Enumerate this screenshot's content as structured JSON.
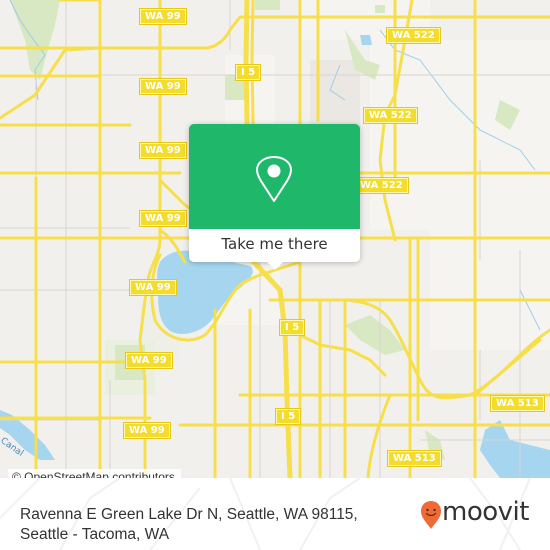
{
  "map": {
    "attribution": "© OpenStreetMap contributors",
    "water_label": "Canal",
    "shields": [
      {
        "label": "WA 99"
      },
      {
        "label": "WA 99"
      },
      {
        "label": "I 5"
      },
      {
        "label": "WA 522"
      },
      {
        "label": "WA 99"
      },
      {
        "label": "WA 522"
      },
      {
        "label": "WA 99"
      },
      {
        "label": "WA 522"
      },
      {
        "label": "WA 99"
      },
      {
        "label": "WA 99"
      },
      {
        "label": "WA 99"
      },
      {
        "label": "I 5"
      },
      {
        "label": "WA 99"
      },
      {
        "label": "I 5"
      },
      {
        "label": "WA 513"
      },
      {
        "label": "WA 513"
      }
    ],
    "colors": {
      "land": "#f2f0ed",
      "road": "#f6df4b",
      "water": "#a6d6ef",
      "park": "#cfe5b1"
    }
  },
  "popup": {
    "icon": "location-pin-icon",
    "button_label": "Take me there",
    "accent_color": "#1fb86a"
  },
  "footer": {
    "address_line1": "Ravenna E Green Lake Dr N, Seattle, WA 98115,",
    "address_line2": "Seattle - Tacoma, WA",
    "brand": "moovit",
    "brand_color": "#f06a35"
  }
}
